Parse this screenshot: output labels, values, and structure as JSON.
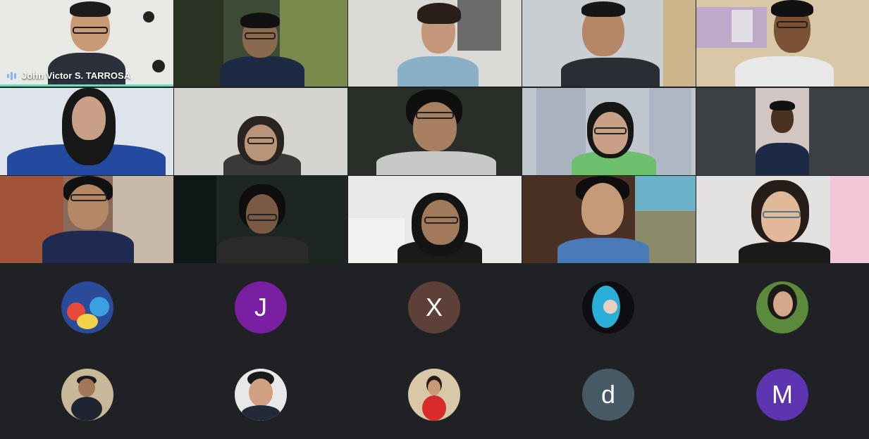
{
  "meeting": {
    "active_speaker_name": "John Victor S. TARROSA",
    "colors": {
      "background": "#202124",
      "active_border": "#7dd3c0",
      "speaking_icon": "#8ab4f8"
    }
  },
  "avatars": [
    {
      "kind": "image",
      "icon": "cartoon-group-avatar-icon"
    },
    {
      "kind": "letter",
      "letter": "J",
      "color": "#7b1fa2"
    },
    {
      "kind": "letter",
      "letter": "X",
      "color": "#5d4037"
    },
    {
      "kind": "image",
      "icon": "anime-character-avatar-icon"
    },
    {
      "kind": "image",
      "icon": "girl-photo-avatar-icon"
    },
    {
      "kind": "image",
      "icon": "man-photo-avatar-icon"
    },
    {
      "kind": "image",
      "icon": "boy-formal-photo-avatar-icon"
    },
    {
      "kind": "image",
      "icon": "woman-red-dress-avatar-icon"
    },
    {
      "kind": "letter",
      "letter": "d",
      "color": "#455a64"
    },
    {
      "kind": "letter",
      "letter": "M",
      "color": "#5e35b1"
    }
  ]
}
